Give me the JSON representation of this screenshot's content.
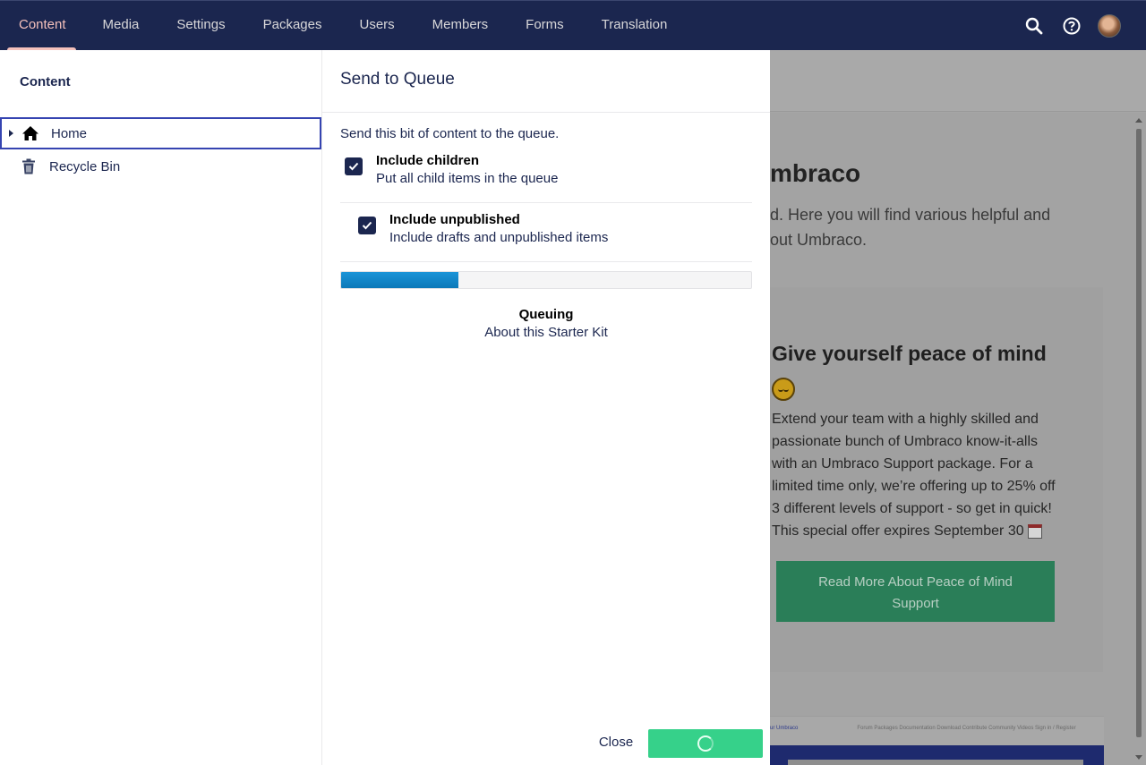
{
  "nav": {
    "items": [
      {
        "label": "Content",
        "active": true
      },
      {
        "label": "Media"
      },
      {
        "label": "Settings"
      },
      {
        "label": "Packages"
      },
      {
        "label": "Users"
      },
      {
        "label": "Members"
      },
      {
        "label": "Forms"
      },
      {
        "label": "Translation"
      }
    ],
    "tools": [
      "search-icon",
      "help-icon",
      "user-avatar"
    ]
  },
  "tree": {
    "title": "Content",
    "items": [
      {
        "label": "Home",
        "icon": "home-icon",
        "selected": true
      },
      {
        "label": "Recycle Bin",
        "icon": "trash-icon"
      }
    ]
  },
  "dialog": {
    "title": "Send to Queue",
    "description": "Send this bit of content to the queue.",
    "options": [
      {
        "label": "Include children",
        "description": "Put all child items in the queue",
        "checked": true
      },
      {
        "label": "Include unpublished",
        "description": "Include drafts and unpublished items",
        "checked": true
      }
    ],
    "progress": 0.285,
    "status_title": "Queuing",
    "status_item": "About this Starter Kit",
    "close_label": "Close"
  },
  "preview": {
    "heading": "mbraco",
    "lead": "d. Here you will find various helpful and out Umbraco.",
    "card_heading": "Give yourself peace of mind",
    "card_text": "Extend your team with a highly skilled and passionate bunch of Umbraco know-it-alls with an Umbraco Support package. For a limited time only, we’re offering up to 25% off 3 different levels of support - so get in quick! This special offer expires September 30",
    "card_button": "Read More About Peace of Mind Support",
    "thumb_brand": "ur Umbraco",
    "thumb_nav": "Forum   Packages   Documentation   Download   Contribute   Community   Videos   Sign in / Register"
  },
  "colors": {
    "topbar": "#1b264f",
    "accent": "#f5c1bc",
    "success": "#36d18a",
    "progress": "#1a94d8"
  }
}
